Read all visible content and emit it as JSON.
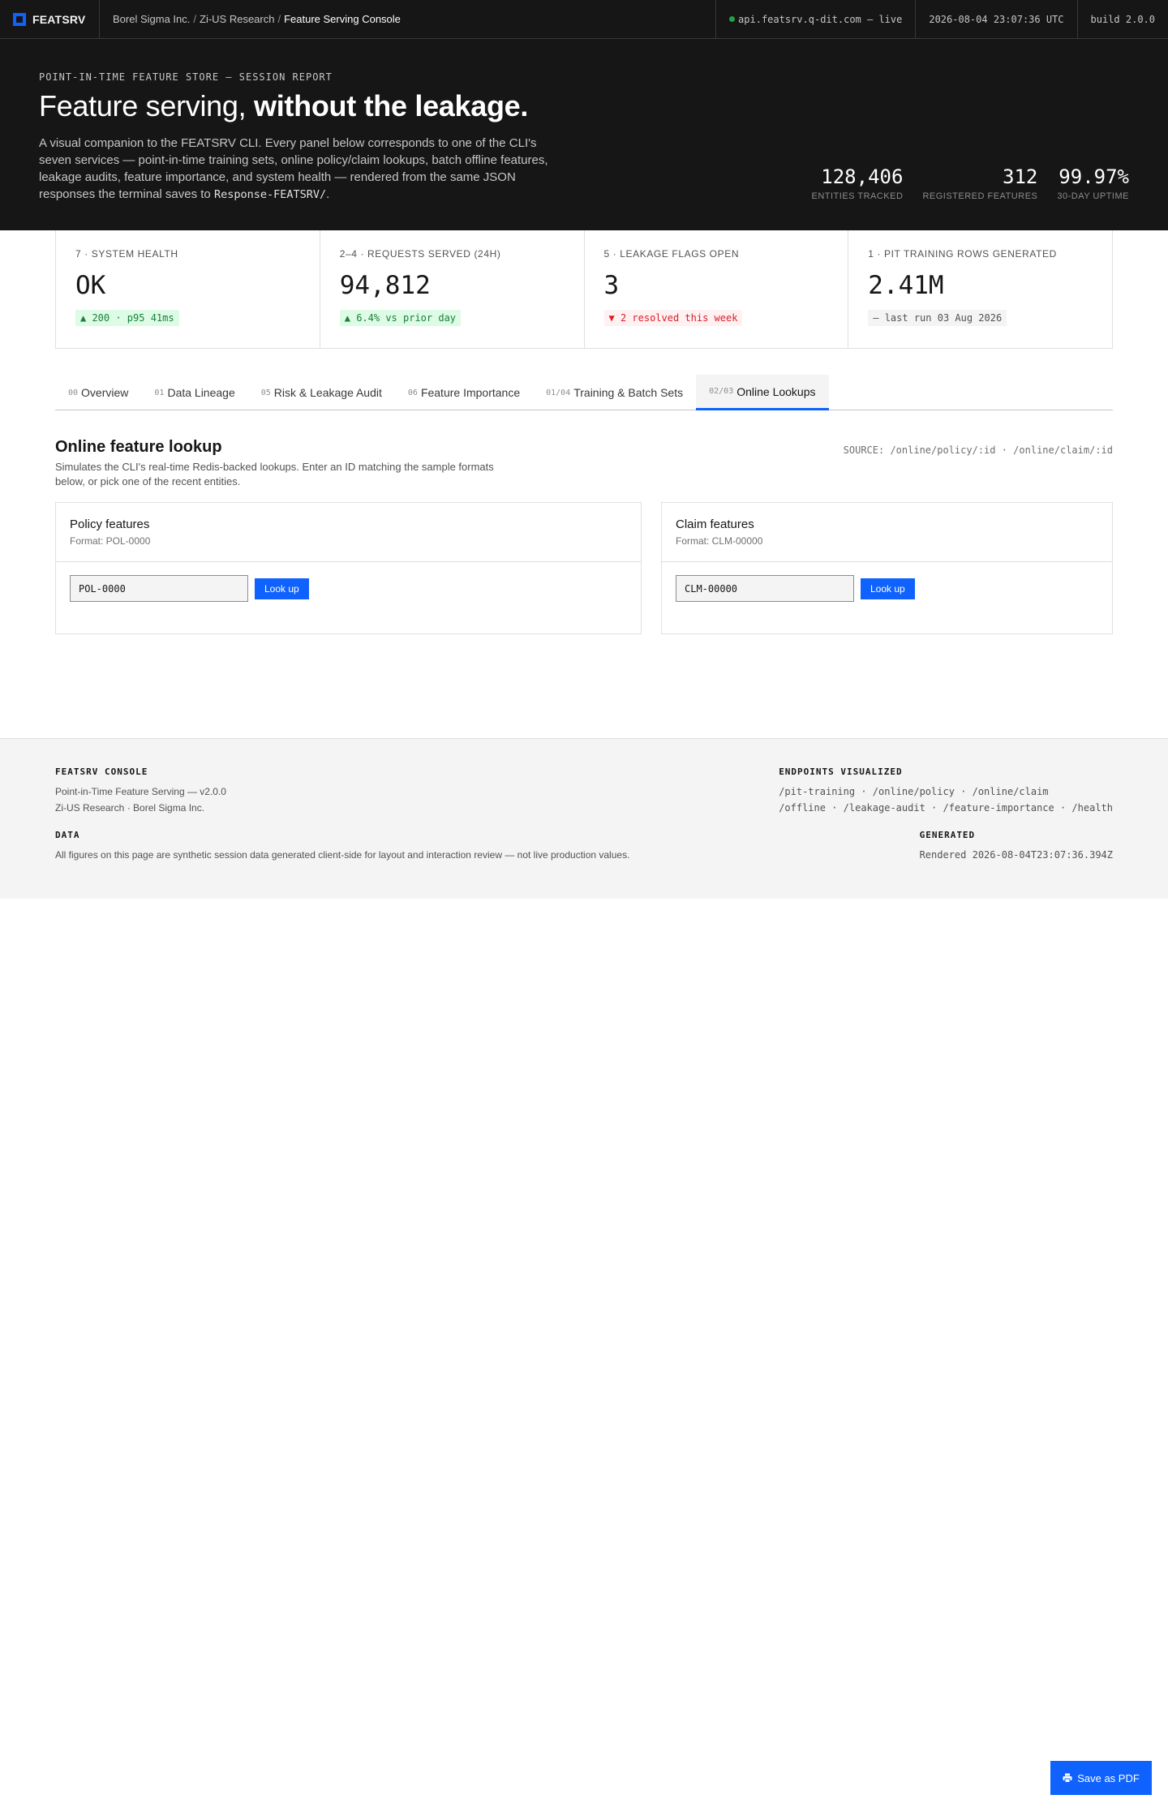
{
  "topbar": {
    "brand": "FEATSRV",
    "breadcrumb": [
      "Borel Sigma Inc.",
      "Zi-US Research",
      "Feature Serving Console"
    ],
    "separator": "/",
    "api_status": "api.featsrv.q-dit.com — live",
    "timestamp": "2026-08-04 23:07:36 UTC",
    "build": "build 2.0.0"
  },
  "hero": {
    "eyebrow": "POINT-IN-TIME FEATURE STORE — SESSION REPORT",
    "title_light": "Feature serving, ",
    "title_bold": "without the leakage.",
    "desc_text": "A visual companion to the FEATSRV CLI. Every panel below corresponds to one of the CLI's seven services — point-in-time training sets, online policy/claim lookups, batch offline features, leakage audits, feature importance, and system health — rendered from the same JSON responses the terminal saves to ",
    "desc_code": "Response-FEATSRV/",
    "desc_end": ".",
    "stats": [
      {
        "value": "128,406",
        "label": "ENTITIES TRACKED"
      },
      {
        "value": "312",
        "label": "REGISTERED FEATURES"
      },
      {
        "value": "99.97%",
        "label": "30-DAY UPTIME"
      }
    ]
  },
  "kpis": [
    {
      "label": "7 · SYSTEM HEALTH",
      "value": "OK",
      "badge": "▲ 200 · p95 41ms",
      "tone": "green"
    },
    {
      "label": "2–4 · REQUESTS SERVED (24H)",
      "value": "94,812",
      "badge": "▲ 6.4% vs prior day",
      "tone": "green"
    },
    {
      "label": "5 · LEAKAGE FLAGS OPEN",
      "value": "3",
      "badge": "▼ 2 resolved this week",
      "tone": "red"
    },
    {
      "label": "1 · PIT TRAINING ROWS GENERATED",
      "value": "2.41M",
      "badge": "— last run 03 Aug 2026",
      "tone": "gray"
    }
  ],
  "tabs": [
    {
      "num": "00",
      "label": "Overview",
      "active": false
    },
    {
      "num": "01",
      "label": "Data Lineage",
      "active": false
    },
    {
      "num": "05",
      "label": "Risk & Leakage Audit",
      "active": false
    },
    {
      "num": "06",
      "label": "Feature Importance",
      "active": false
    },
    {
      "num": "01/04",
      "label": "Training & Batch Sets",
      "active": false
    },
    {
      "num": "02/03",
      "label": "Online Lookups",
      "active": true
    }
  ],
  "section": {
    "title": "Online feature lookup",
    "desc": "Simulates the CLI's real-time Redis-backed lookups. Enter an ID matching the sample formats below, or pick one of the recent entities.",
    "source": "SOURCE: /online/policy/:id · /online/claim/:id"
  },
  "panels": {
    "policy": {
      "title": "Policy features",
      "format": "Format: POL-0000",
      "input_value": "POL-0000",
      "button": "Look up"
    },
    "claim": {
      "title": "Claim features",
      "format": "Format: CLM-00000",
      "input_value": "CLM-00000",
      "button": "Look up"
    }
  },
  "footer": {
    "console_head": "FEATSRV CONSOLE",
    "console_line1": "Point-in-Time Feature Serving — v2.0.0",
    "console_line2": "Zi-US Research · Borel Sigma Inc.",
    "data_head": "DATA",
    "data_text": "All figures on this page are synthetic session data generated client-side for layout and interaction review — not live production values.",
    "endpoints_head": "ENDPOINTS VISUALIZED",
    "endpoints_line1": "/pit-training · /online/policy · /online/claim",
    "endpoints_line2": "/offline · /leakage-audit · /feature-importance · /health",
    "generated_head": "GENERATED",
    "generated_text": "Rendered 2026-08-04T23:07:36.394Z"
  },
  "save_button": "Save as PDF",
  "colors": {
    "accent": "#0f62fe",
    "dark": "#161616",
    "live": "#24a148",
    "danger": "#da1e28"
  }
}
